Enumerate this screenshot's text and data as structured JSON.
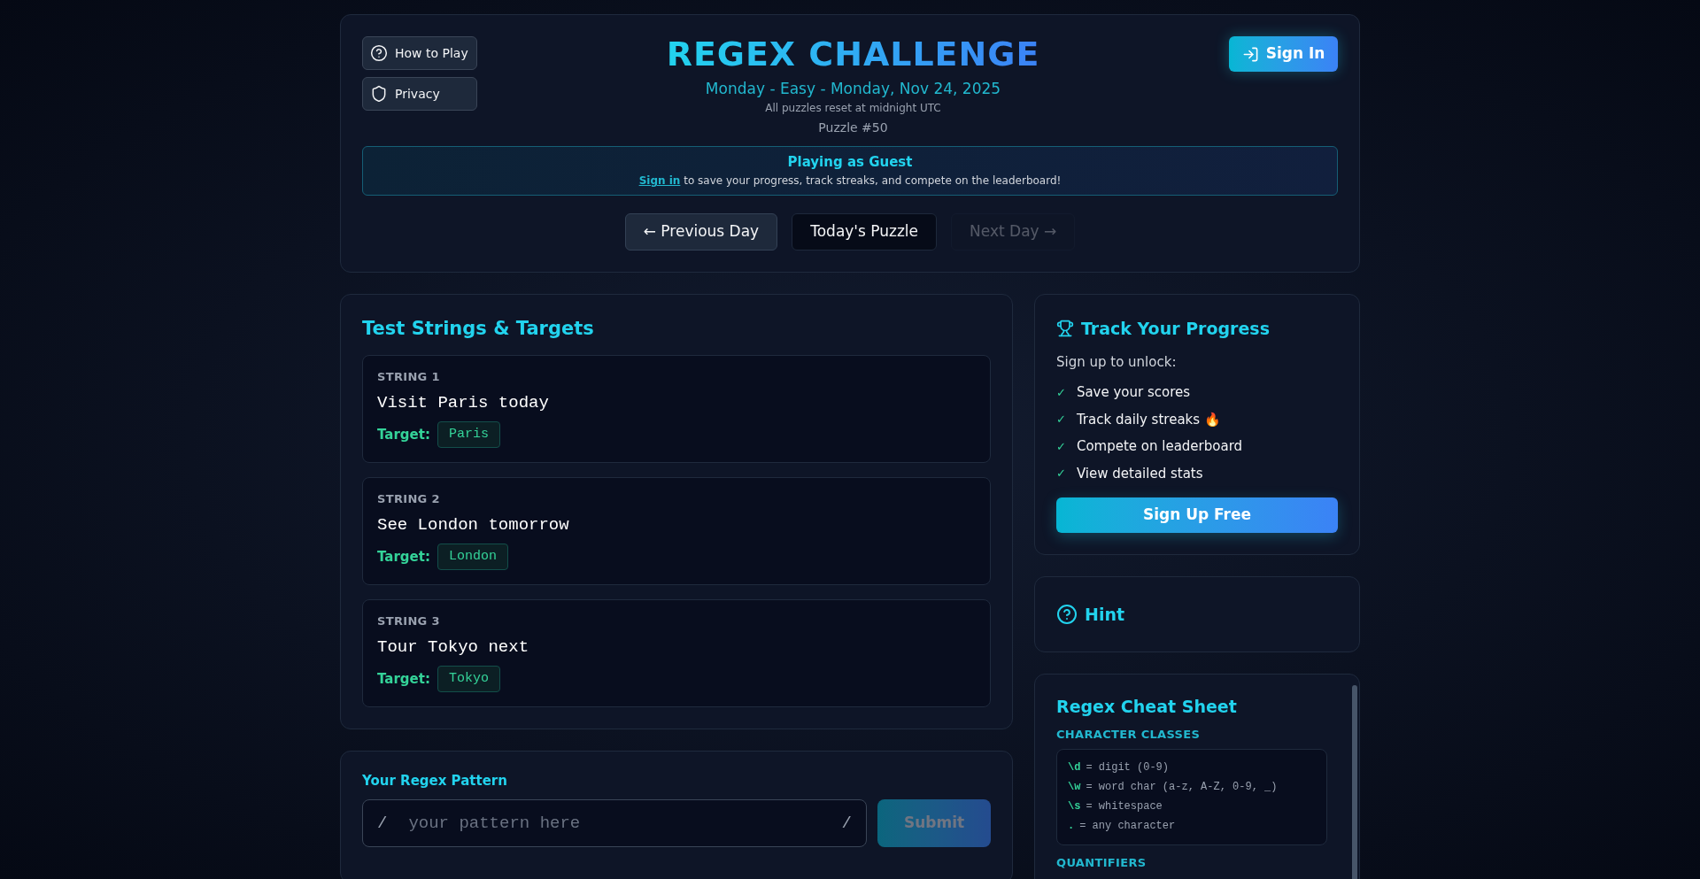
{
  "header": {
    "title": "REGEX CHALLENGE",
    "subtitle": "Monday - Easy - Monday, Nov 24, 2025",
    "reset_note": "All puzzles reset at midnight UTC",
    "puzzle_number": "Puzzle #50",
    "side_buttons": [
      {
        "kind": "help",
        "label": "How to Play"
      },
      {
        "kind": "privacy",
        "label": "Privacy"
      }
    ],
    "sign_in": "Sign In"
  },
  "guest_banner": {
    "title": "Playing as Guest",
    "link": "Sign in",
    "text": " to save your progress, track streaks, and compete on the leaderboard!"
  },
  "day_nav": [
    {
      "label": "← Previous Day",
      "kind": "prev",
      "disabled": false
    },
    {
      "label": "Today's Puzzle",
      "kind": "today",
      "disabled": false
    },
    {
      "label": "Next Day →",
      "kind": "next",
      "disabled": true
    }
  ],
  "test_strings": {
    "title": "Test Strings & Targets",
    "items": [
      {
        "label": "STRING 1",
        "text": "Visit Paris today",
        "target_label": "Target:",
        "target": "Paris"
      },
      {
        "label": "STRING 2",
        "text": "See London tomorrow",
        "target_label": "Target:",
        "target": "London"
      },
      {
        "label": "STRING 3",
        "text": "Tour Tokyo next",
        "target_label": "Target:",
        "target": "Tokyo"
      }
    ]
  },
  "pattern": {
    "label": "Your Regex Pattern",
    "open": "/",
    "close": "/",
    "placeholder": "your pattern here",
    "submit": "Submit",
    "submit_disabled": true
  },
  "progress": {
    "title": "Track Your Progress",
    "intro": "Sign up to unlock:",
    "check": "✓",
    "features": [
      "Save your scores",
      "Track daily streaks 🔥",
      "Compete on leaderboard",
      "View detailed stats"
    ],
    "button": "Sign Up Free"
  },
  "hint": {
    "title": "Hint"
  },
  "cheat_sheet": {
    "title": "Regex Cheat Sheet",
    "sections": [
      {
        "heading": "CHARACTER CLASSES",
        "entries": [
          {
            "token": "\\d",
            "meaning": "= digit (0-9)"
          },
          {
            "token": "\\w",
            "meaning": "= word char (a-z, A-Z, 0-9, _)"
          },
          {
            "token": "\\s",
            "meaning": "= whitespace"
          },
          {
            "token": ".",
            "meaning": "= any character"
          }
        ]
      },
      {
        "heading": "QUANTIFIERS"
      }
    ]
  }
}
